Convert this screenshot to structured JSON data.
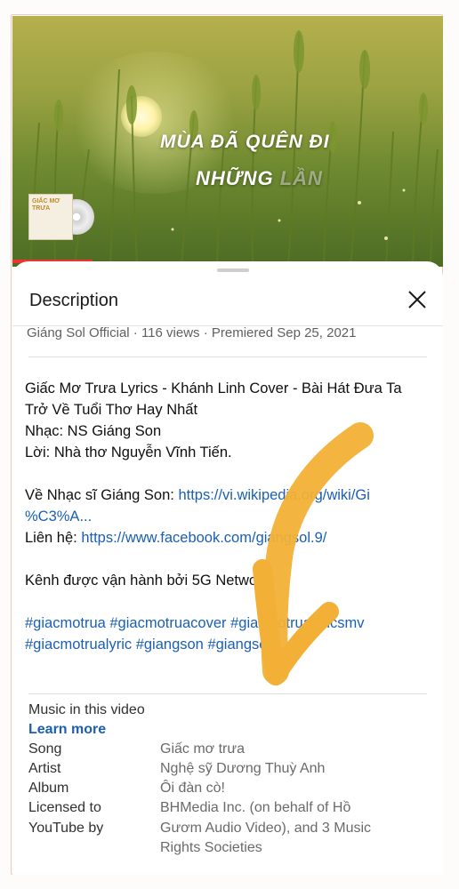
{
  "video": {
    "title_line1": "mùa đã quên đi",
    "title_line2_bold": "những",
    "title_line2_faded": "lần",
    "thumb_text": "GIẤC MƠ TRƯA"
  },
  "description": {
    "header": "Description",
    "meta": "Giáng Sol Official · 116 views · Premiered Sep 25, 2021",
    "line1": "Giấc Mơ Trưa Lyrics - Khánh Linh Cover - Bài Hát Đưa Ta",
    "line2": "Trở Về Tuổi Thơ Hay Nhất",
    "line3": "Nhạc: NS Giáng Son",
    "line4": "Lời: Nhà thơ Nguyễn Vĩnh Tiến.",
    "about_label": "Về Nhạc sĩ Giáng Son: ",
    "about_link1": "https://vi.wikipedia.org/wiki/Gi",
    "about_link2": "%C3%A...",
    "contact_label": "Liên hệ: ",
    "contact_link": "https://www.facebook.com/giangsol.9/",
    "operated": "Kênh được vận hành bởi 5G Network",
    "hashtags1": "#giacmotrua #giacmotruacover #giacmotrualyricsmv",
    "hashtags2": "#giacmotrualyric #giangson #giangsol"
  },
  "music": {
    "heading": "Music in this video",
    "learn_more": "Learn more",
    "rows": [
      {
        "label": "Song",
        "value": "Giấc mơ trưa"
      },
      {
        "label": "Artist",
        "value": "Nghệ sỹ Dương Thuỳ Anh"
      },
      {
        "label": "Album",
        "value": "Ôi đàn cò!"
      },
      {
        "label": "Licensed to",
        "value": "BHMedia Inc. (on behalf of Hồ"
      },
      {
        "label": "YouTube by",
        "value": "Gươm Audio Video), and 3 Music"
      },
      {
        "label": "",
        "value": "Rights Societies"
      }
    ]
  },
  "colors": {
    "link": "#1a5fb4",
    "annotation_arrow": "#f2b136",
    "progress": "#e33333"
  },
  "icons": {
    "close": "close-icon",
    "annotation": "arrow-annotation-icon"
  }
}
